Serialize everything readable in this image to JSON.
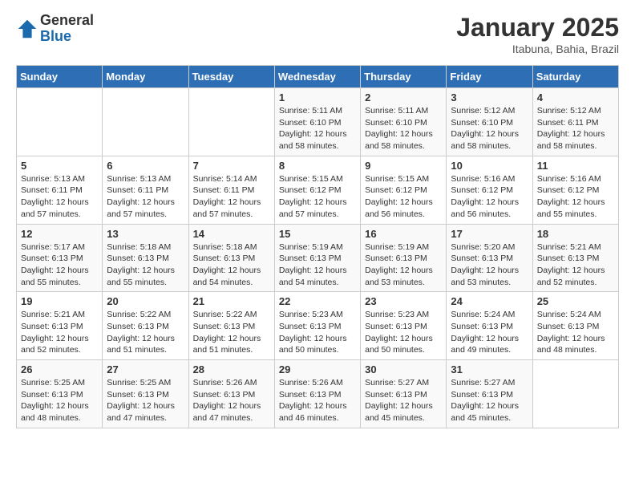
{
  "header": {
    "logo_general": "General",
    "logo_blue": "Blue",
    "month_title": "January 2025",
    "location": "Itabuna, Bahia, Brazil"
  },
  "days_of_week": [
    "Sunday",
    "Monday",
    "Tuesday",
    "Wednesday",
    "Thursday",
    "Friday",
    "Saturday"
  ],
  "weeks": [
    [
      {
        "day": "",
        "sunrise": "",
        "sunset": "",
        "daylight": ""
      },
      {
        "day": "",
        "sunrise": "",
        "sunset": "",
        "daylight": ""
      },
      {
        "day": "",
        "sunrise": "",
        "sunset": "",
        "daylight": ""
      },
      {
        "day": "1",
        "sunrise": "Sunrise: 5:11 AM",
        "sunset": "Sunset: 6:10 PM",
        "daylight": "Daylight: 12 hours and 58 minutes."
      },
      {
        "day": "2",
        "sunrise": "Sunrise: 5:11 AM",
        "sunset": "Sunset: 6:10 PM",
        "daylight": "Daylight: 12 hours and 58 minutes."
      },
      {
        "day": "3",
        "sunrise": "Sunrise: 5:12 AM",
        "sunset": "Sunset: 6:10 PM",
        "daylight": "Daylight: 12 hours and 58 minutes."
      },
      {
        "day": "4",
        "sunrise": "Sunrise: 5:12 AM",
        "sunset": "Sunset: 6:11 PM",
        "daylight": "Daylight: 12 hours and 58 minutes."
      }
    ],
    [
      {
        "day": "5",
        "sunrise": "Sunrise: 5:13 AM",
        "sunset": "Sunset: 6:11 PM",
        "daylight": "Daylight: 12 hours and 57 minutes."
      },
      {
        "day": "6",
        "sunrise": "Sunrise: 5:13 AM",
        "sunset": "Sunset: 6:11 PM",
        "daylight": "Daylight: 12 hours and 57 minutes."
      },
      {
        "day": "7",
        "sunrise": "Sunrise: 5:14 AM",
        "sunset": "Sunset: 6:11 PM",
        "daylight": "Daylight: 12 hours and 57 minutes."
      },
      {
        "day": "8",
        "sunrise": "Sunrise: 5:15 AM",
        "sunset": "Sunset: 6:12 PM",
        "daylight": "Daylight: 12 hours and 57 minutes."
      },
      {
        "day": "9",
        "sunrise": "Sunrise: 5:15 AM",
        "sunset": "Sunset: 6:12 PM",
        "daylight": "Daylight: 12 hours and 56 minutes."
      },
      {
        "day": "10",
        "sunrise": "Sunrise: 5:16 AM",
        "sunset": "Sunset: 6:12 PM",
        "daylight": "Daylight: 12 hours and 56 minutes."
      },
      {
        "day": "11",
        "sunrise": "Sunrise: 5:16 AM",
        "sunset": "Sunset: 6:12 PM",
        "daylight": "Daylight: 12 hours and 55 minutes."
      }
    ],
    [
      {
        "day": "12",
        "sunrise": "Sunrise: 5:17 AM",
        "sunset": "Sunset: 6:13 PM",
        "daylight": "Daylight: 12 hours and 55 minutes."
      },
      {
        "day": "13",
        "sunrise": "Sunrise: 5:18 AM",
        "sunset": "Sunset: 6:13 PM",
        "daylight": "Daylight: 12 hours and 55 minutes."
      },
      {
        "day": "14",
        "sunrise": "Sunrise: 5:18 AM",
        "sunset": "Sunset: 6:13 PM",
        "daylight": "Daylight: 12 hours and 54 minutes."
      },
      {
        "day": "15",
        "sunrise": "Sunrise: 5:19 AM",
        "sunset": "Sunset: 6:13 PM",
        "daylight": "Daylight: 12 hours and 54 minutes."
      },
      {
        "day": "16",
        "sunrise": "Sunrise: 5:19 AM",
        "sunset": "Sunset: 6:13 PM",
        "daylight": "Daylight: 12 hours and 53 minutes."
      },
      {
        "day": "17",
        "sunrise": "Sunrise: 5:20 AM",
        "sunset": "Sunset: 6:13 PM",
        "daylight": "Daylight: 12 hours and 53 minutes."
      },
      {
        "day": "18",
        "sunrise": "Sunrise: 5:21 AM",
        "sunset": "Sunset: 6:13 PM",
        "daylight": "Daylight: 12 hours and 52 minutes."
      }
    ],
    [
      {
        "day": "19",
        "sunrise": "Sunrise: 5:21 AM",
        "sunset": "Sunset: 6:13 PM",
        "daylight": "Daylight: 12 hours and 52 minutes."
      },
      {
        "day": "20",
        "sunrise": "Sunrise: 5:22 AM",
        "sunset": "Sunset: 6:13 PM",
        "daylight": "Daylight: 12 hours and 51 minutes."
      },
      {
        "day": "21",
        "sunrise": "Sunrise: 5:22 AM",
        "sunset": "Sunset: 6:13 PM",
        "daylight": "Daylight: 12 hours and 51 minutes."
      },
      {
        "day": "22",
        "sunrise": "Sunrise: 5:23 AM",
        "sunset": "Sunset: 6:13 PM",
        "daylight": "Daylight: 12 hours and 50 minutes."
      },
      {
        "day": "23",
        "sunrise": "Sunrise: 5:23 AM",
        "sunset": "Sunset: 6:13 PM",
        "daylight": "Daylight: 12 hours and 50 minutes."
      },
      {
        "day": "24",
        "sunrise": "Sunrise: 5:24 AM",
        "sunset": "Sunset: 6:13 PM",
        "daylight": "Daylight: 12 hours and 49 minutes."
      },
      {
        "day": "25",
        "sunrise": "Sunrise: 5:24 AM",
        "sunset": "Sunset: 6:13 PM",
        "daylight": "Daylight: 12 hours and 48 minutes."
      }
    ],
    [
      {
        "day": "26",
        "sunrise": "Sunrise: 5:25 AM",
        "sunset": "Sunset: 6:13 PM",
        "daylight": "Daylight: 12 hours and 48 minutes."
      },
      {
        "day": "27",
        "sunrise": "Sunrise: 5:25 AM",
        "sunset": "Sunset: 6:13 PM",
        "daylight": "Daylight: 12 hours and 47 minutes."
      },
      {
        "day": "28",
        "sunrise": "Sunrise: 5:26 AM",
        "sunset": "Sunset: 6:13 PM",
        "daylight": "Daylight: 12 hours and 47 minutes."
      },
      {
        "day": "29",
        "sunrise": "Sunrise: 5:26 AM",
        "sunset": "Sunset: 6:13 PM",
        "daylight": "Daylight: 12 hours and 46 minutes."
      },
      {
        "day": "30",
        "sunrise": "Sunrise: 5:27 AM",
        "sunset": "Sunset: 6:13 PM",
        "daylight": "Daylight: 12 hours and 45 minutes."
      },
      {
        "day": "31",
        "sunrise": "Sunrise: 5:27 AM",
        "sunset": "Sunset: 6:13 PM",
        "daylight": "Daylight: 12 hours and 45 minutes."
      },
      {
        "day": "",
        "sunrise": "",
        "sunset": "",
        "daylight": ""
      }
    ]
  ]
}
